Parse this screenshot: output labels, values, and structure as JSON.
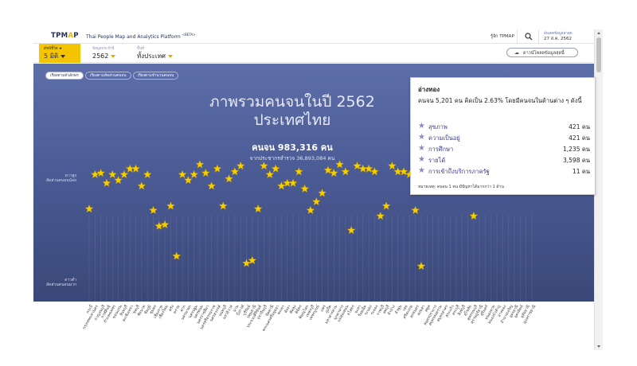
{
  "header": {
    "logo_main": "TPM",
    "logo_accent": "A",
    "logo_end": "P",
    "title": "Thai People Map and Analytics Platform",
    "title_badge": "<BETA>",
    "about": "รู้จัก TPMAP",
    "search_icon": "search-icon",
    "updated_label": "อัพเดตข้อมูลล่าสุด",
    "updated_value": "27 ส.ค. 2562"
  },
  "filters": {
    "dimension_sub": "ดัชนีชี้วัด ★",
    "dimension_value": "5 มิติ",
    "year_sub": "ข้อมูลประจำปี",
    "year_value": "2562",
    "area_sub": "พื้นที่",
    "area_value": "ทั้งประเทศ",
    "download_label": "ดาวน์โหลดข้อมูลสุดนี้"
  },
  "sort_tabs": [
    {
      "label": "เรียงตามตัวอักษร",
      "active": true
    },
    {
      "label": "เรียงตามสัดส่วนคนจน",
      "active": false
    },
    {
      "label": "เรียงตามจำนวนคนจน",
      "active": false
    }
  ],
  "overview": {
    "title_line1": "ภาพรวมคนจนในปี 2562",
    "title_line2": "ประเทศไทย",
    "poor_count": "คนจน 983,316 คน",
    "survey_total": "จากประชากรสำรวจ 36,893,084 คน"
  },
  "axis": {
    "top_line1": "ดาวสูง",
    "top_line2": "สัดส่วนคนจนน้อย",
    "bottom_line1": "ดาวต่ำ",
    "bottom_line2": "สัดส่วนคนจนมาก"
  },
  "tooltip": {
    "title": "อ่างทอง",
    "description": "คนจน 5,201 คน คิดเป็น 2.63% โดยมีคนจนในด้านต่าง ๆ ดังนี้",
    "rows": [
      {
        "name": "สุขภาพ",
        "value": "421 คน",
        "icon": "star-icon"
      },
      {
        "name": "ความเป็นอยู่",
        "value": "421 คน",
        "icon": "star-icon"
      },
      {
        "name": "การศึกษา",
        "value": "1,235 คน",
        "icon": "star-icon"
      },
      {
        "name": "รายได้",
        "value": "3,598 คน",
        "icon": "star-icon"
      },
      {
        "name": "การเข้าถึงบริการภาครัฐ",
        "value": "11 คน",
        "icon": "star-icon"
      }
    ],
    "note": "หมายเหตุ: คนจน 1 คน มีปัญหาได้มากกว่า 1 ด้าน"
  },
  "colors": {
    "accent_yellow": "#f5c400",
    "star_fill": "#f5d000",
    "star_stroke": "#c79a00",
    "panel_navy": "#4b5b95",
    "brand_navy": "#1f2d5c",
    "tooltip_icon": "#8c88c4"
  },
  "chart_data": {
    "type": "scatter",
    "y_meaning": "star level: ดาวสูง (top) to ดาวต่ำ (bottom)",
    "ylim": [
      0,
      1
    ],
    "x": [
      "กระบี่",
      "กรุงเทพมหานคร",
      "กาญจนบุรี",
      "กาฬสินธุ์",
      "กำแพงเพชร",
      "ขอนแก่น",
      "จันทบุรี",
      "ฉะเชิงเทรา",
      "ชลบุรี",
      "ชัยนาท",
      "ชัยภูมิ",
      "ชุมพร",
      "เชียงราย",
      "เชียงใหม่",
      "ตรัง",
      "ตราด",
      "ตาก",
      "นครนายก",
      "นครปฐม",
      "นครพนม",
      "นครราชสีมา",
      "นครศรีธรรมราช",
      "นครสวรรค์",
      "นนทบุรี",
      "นราธิวาส",
      "น่าน",
      "บึงกาฬ",
      "บุรีรัมย์",
      "ปทุมธานี",
      "ประจวบคีรีขันธ์",
      "ปราจีนบุรี",
      "ปัตตานี",
      "พระนครศรีอยุธยา",
      "พะเยา",
      "พังงา",
      "พัทลุง",
      "พิจิตร",
      "พิษณุโลก",
      "เพชรบุรี",
      "เพชรบูรณ์",
      "แพร่",
      "ภูเก็ต",
      "มหาสารคาม",
      "มุกดาหาร",
      "แม่ฮ่องสอน",
      "ยโสธร",
      "ยะลา",
      "ร้อยเอ็ด",
      "ระนอง",
      "ระยอง",
      "ราชบุรี",
      "ลพบุรี",
      "ลำปาง",
      "ลำพูน",
      "เลย",
      "ศรีสะเกษ",
      "สกลนคร",
      "สงขลา",
      "สตูล",
      "สมุทรปราการ",
      "สมุทรสงคราม",
      "สมุทรสาคร",
      "สระแก้ว",
      "สระบุรี",
      "สิงห์บุรี",
      "สุโขทัย",
      "สุพรรณบุรี",
      "สุราษฎร์ธานี",
      "สุรินทร์",
      "หนองคาย",
      "หนองบัวลำภู",
      "อ่างทอง",
      "อำนาจเจริญ",
      "อุดรธานี",
      "อุตรดิตถ์",
      "อุทัยธานี",
      "อุบลราชธานี"
    ],
    "y": [
      0.58,
      0.82,
      0.83,
      0.76,
      0.82,
      0.78,
      0.82,
      0.86,
      0.86,
      0.74,
      0.82,
      0.57,
      0.46,
      0.47,
      0.6,
      0.25,
      0.82,
      0.78,
      0.82,
      0.89,
      0.83,
      0.74,
      0.86,
      0.6,
      0.79,
      0.84,
      0.88,
      0.2,
      0.22,
      0.58,
      0.88,
      0.82,
      0.86,
      0.74,
      0.76,
      0.76,
      0.84,
      0.72,
      0.57,
      0.63,
      0.69,
      0.85,
      0.83,
      0.89,
      0.84,
      0.43,
      0.88,
      0.86,
      0.86,
      0.84,
      0.53,
      0.6,
      0.88,
      0.84,
      0.84,
      0.82,
      0.57,
      0.18,
      0.88,
      0.85,
      0.79,
      0.76,
      0.84,
      0.82,
      0.77,
      0.82,
      0.53,
      0.84,
      0.84,
      0.76,
      0.78,
      0.76,
      0.78,
      0.82,
      0.85,
      0.84,
      0.82
    ],
    "highlighted": "อ่างทอง"
  }
}
